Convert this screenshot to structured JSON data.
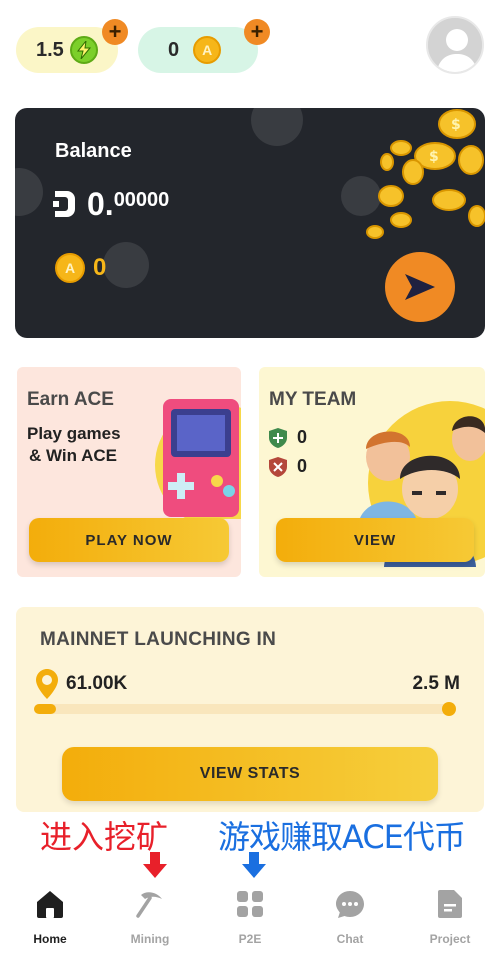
{
  "topbar": {
    "energy_value": "1.5",
    "coin_value": "0",
    "plus_label": "+",
    "coin_symbol": "A"
  },
  "balance": {
    "title": "Balance",
    "amount_main": "0.",
    "amount_decimals": "00000",
    "coin_count": "0",
    "coin_symbol": "A"
  },
  "earn_card": {
    "title": "Earn ACE",
    "subtitle_line1": "Play games",
    "subtitle_line2": "& Win ACE",
    "button_label": "PLAY NOW"
  },
  "team_card": {
    "title": "MY TEAM",
    "active_count": "0",
    "inactive_count": "0",
    "button_label": "VIEW"
  },
  "mainnet": {
    "title": "MAINNET LAUNCHING IN",
    "current": "61.00K",
    "target": "2.5 M",
    "progress_percent": 2.44,
    "button_label": "VIEW STATS"
  },
  "annotations": {
    "mining_hint": "进入挖矿",
    "p2e_hint": "游戏赚取ACE代币"
  },
  "nav": {
    "items": [
      {
        "label": "Home",
        "icon": "home-icon",
        "active": true
      },
      {
        "label": "Mining",
        "icon": "pickaxe-icon",
        "active": false
      },
      {
        "label": "P2E",
        "icon": "grid-icon",
        "active": false
      },
      {
        "label": "Chat",
        "icon": "chat-icon",
        "active": false
      },
      {
        "label": "Project",
        "icon": "document-icon",
        "active": false
      }
    ]
  },
  "colors": {
    "accent": "#f3ad0b",
    "orange": "#f08a24",
    "card_dark": "#23262c",
    "annotation_red": "#e8202a",
    "annotation_blue": "#1a6fe0"
  }
}
